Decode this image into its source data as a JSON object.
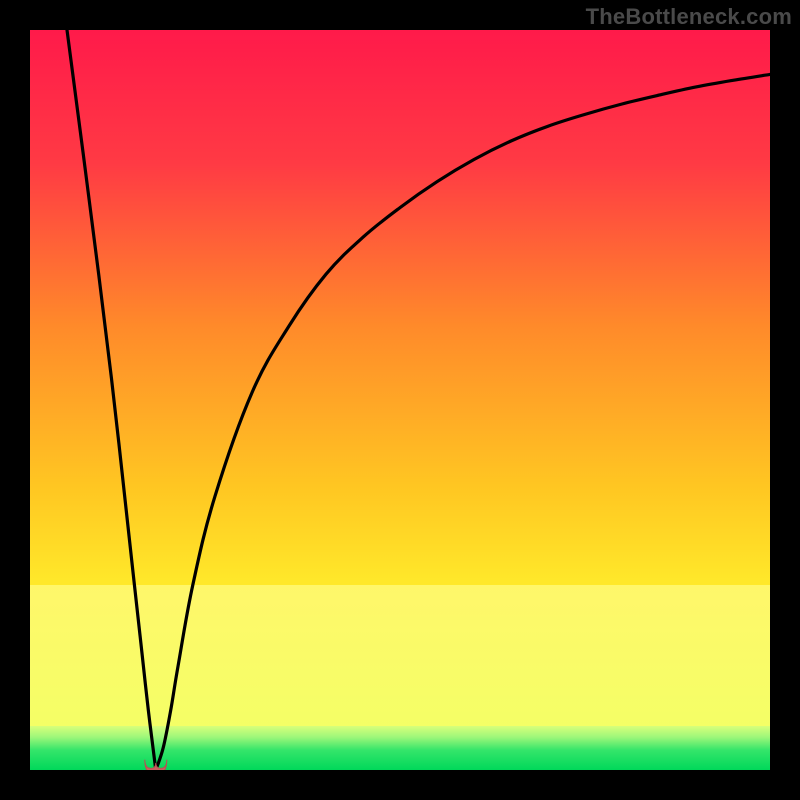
{
  "watermark": "TheBottleneck.com",
  "chart_data": {
    "type": "line",
    "title": "",
    "xlabel": "",
    "ylabel": "",
    "xlim": [
      0,
      100
    ],
    "ylim": [
      0,
      100
    ],
    "grid": false,
    "legend": false,
    "background": {
      "top_color": "#ff1a4a",
      "mid_color": "#ffde2a",
      "bottom_band_color": "#00e55a",
      "yellow_band_top_pct": 75,
      "green_band_top_pct": 94
    },
    "curve": {
      "description": "Bottleneck magnitude vs component ratio; 0 at optimum, rising to both sides.",
      "optimum_x": 17,
      "marker": {
        "shape": "u",
        "color": "#c86060"
      },
      "series": [
        {
          "name": "bottleneck_pct",
          "x": [
            5,
            8,
            11,
            14,
            15,
            16,
            17,
            18,
            19,
            20,
            22,
            25,
            30,
            35,
            40,
            45,
            50,
            55,
            60,
            65,
            70,
            75,
            80,
            85,
            90,
            95,
            100
          ],
          "y": [
            100,
            77,
            53,
            26,
            17,
            8,
            0,
            3,
            8,
            14,
            25,
            37,
            51,
            60,
            67,
            72,
            76,
            79.5,
            82.5,
            85,
            87,
            88.6,
            90,
            91.2,
            92.3,
            93.2,
            94
          ]
        }
      ]
    }
  }
}
